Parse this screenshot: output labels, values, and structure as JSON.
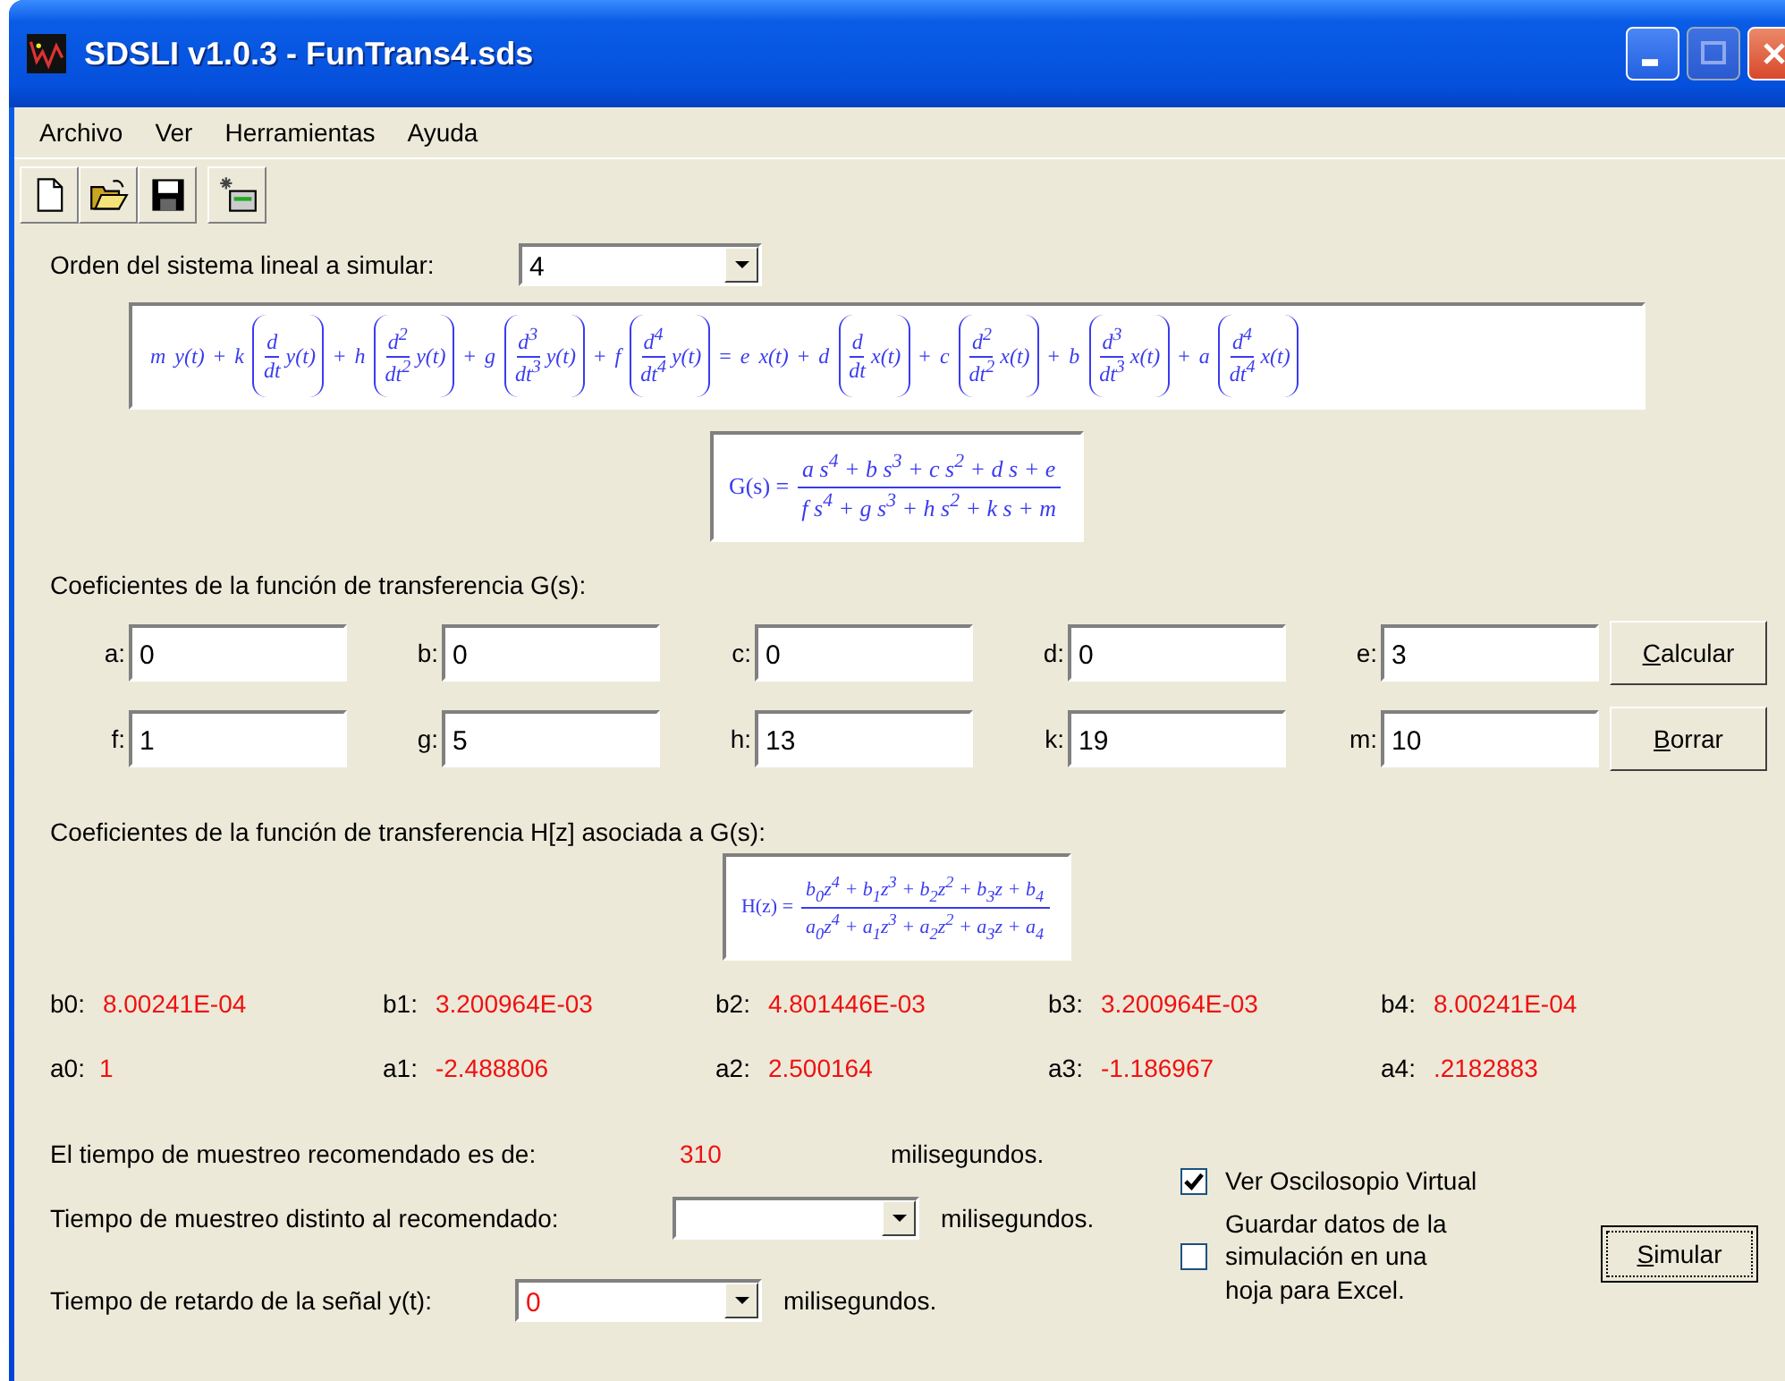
{
  "window": {
    "title": "SDSLI v1.0.3 - FunTrans4.sds"
  },
  "menu": [
    "Archivo",
    "Ver",
    "Herramientas",
    "Ayuda"
  ],
  "order": {
    "label": "Orden del sistema lineal a simular:",
    "value": "4"
  },
  "differential_equation": {
    "equals": "=",
    "lhs": [
      {
        "coef": "m",
        "fn": "y(t)"
      },
      {
        "sign": "+",
        "coef": "k",
        "num": "d",
        "den": "dt",
        "fn": "y(t)"
      },
      {
        "sign": "+",
        "coef": "h",
        "num": "d$^{2}$",
        "den": "dt$^{2}$",
        "fn": "y(t)"
      },
      {
        "sign": "+",
        "coef": "g",
        "num": "d$^{3}$",
        "den": "dt$^{3}$",
        "fn": "y(t)"
      },
      {
        "sign": "+",
        "coef": "f",
        "num": "d$^{4}$",
        "den": "dt$^{4}$",
        "fn": "y(t)"
      }
    ],
    "rhs": [
      {
        "coef": "e",
        "fn": "x(t)"
      },
      {
        "sign": "+",
        "coef": "d",
        "num": "d",
        "den": "dt",
        "fn": "x(t)"
      },
      {
        "sign": "+",
        "coef": "c",
        "num": "d$^{2}$",
        "den": "dt$^{2}$",
        "fn": "x(t)"
      },
      {
        "sign": "+",
        "coef": "b",
        "num": "d$^{3}$",
        "den": "dt$^{3}$",
        "fn": "x(t)"
      },
      {
        "sign": "+",
        "coef": "a",
        "num": "d$^{4}$",
        "den": "dt$^{4}$",
        "fn": "x(t)"
      }
    ]
  },
  "transfer_function_g": {
    "lhs": "G(s) =",
    "numerator": "a s$^{4}$ + b s$^{3}$ + c s$^{2}$ + d s + e",
    "denominator": "f s$^{4}$ + g s$^{3}$ + h s$^{2}$ + k s + m"
  },
  "g_coefficients": {
    "title": "Coeficientes de la función de transferencia G(s):",
    "rows": [
      [
        {
          "label": "a:",
          "value": "0"
        },
        {
          "label": "b:",
          "value": "0"
        },
        {
          "label": "c:",
          "value": "0"
        },
        {
          "label": "d:",
          "value": "0"
        },
        {
          "label": "e:",
          "value": "3"
        }
      ],
      [
        {
          "label": "f:",
          "value": "1"
        },
        {
          "label": "g:",
          "value": "5"
        },
        {
          "label": "h:",
          "value": "13"
        },
        {
          "label": "k:",
          "value": "19"
        },
        {
          "label": "m:",
          "value": "10"
        }
      ]
    ],
    "buttons": [
      "Calcular",
      "Borrar"
    ]
  },
  "h_coefficients": {
    "title": "Coeficientes de la función de transferencia H[z] asociada a G(s):",
    "formula": {
      "lhs": "H(z) =",
      "numerator": "b$_{0}$z$^{4}$ + b$_{1}$z$^{3}$ + b$_{2}$z$^{2}$ + b$_{3}$z + b$_{4}$",
      "denominator": "a$_{0}$z$^{4}$ + a$_{1}$z$^{3}$ + a$_{2}$z$^{2}$ + a$_{3}$z + a$_{4}$"
    },
    "rows": [
      [
        {
          "label": "b0:",
          "value": "8.00241E-04"
        },
        {
          "label": "b1:",
          "value": "3.200964E-03"
        },
        {
          "label": "b2:",
          "value": "4.801446E-03"
        },
        {
          "label": "b3:",
          "value": "3.200964E-03"
        },
        {
          "label": "b4:",
          "value": "8.00241E-04"
        }
      ],
      [
        {
          "label": "a0:",
          "value": "1"
        },
        {
          "label": "a1:",
          "value": "-2.488806"
        },
        {
          "label": "a2:",
          "value": "2.500164"
        },
        {
          "label": "a3:",
          "value": "-1.186967"
        },
        {
          "label": "a4:",
          "value": ".2182883"
        }
      ]
    ]
  },
  "sampling": {
    "recommended_label": "El tiempo de muestreo recomendado es de:",
    "recommended_value": "310",
    "recommended_unit": "milisegundos.",
    "custom_label": "Tiempo de muestreo distinto al recomendado:",
    "custom_unit": "milisegundos.",
    "delay_label": "Tiempo de retardo de la señal y(t):",
    "delay_value": "0",
    "delay_unit": "milisegundos."
  },
  "options": [
    {
      "lines": [
        "Ver Oscilosopio Virtual"
      ],
      "checked": true
    },
    {
      "lines": [
        "Guardar datos de la",
        "simulación en una",
        "hoja para Excel."
      ],
      "checked": false
    }
  ],
  "simulate_button": {
    "label": "Simular",
    "focused": true
  }
}
